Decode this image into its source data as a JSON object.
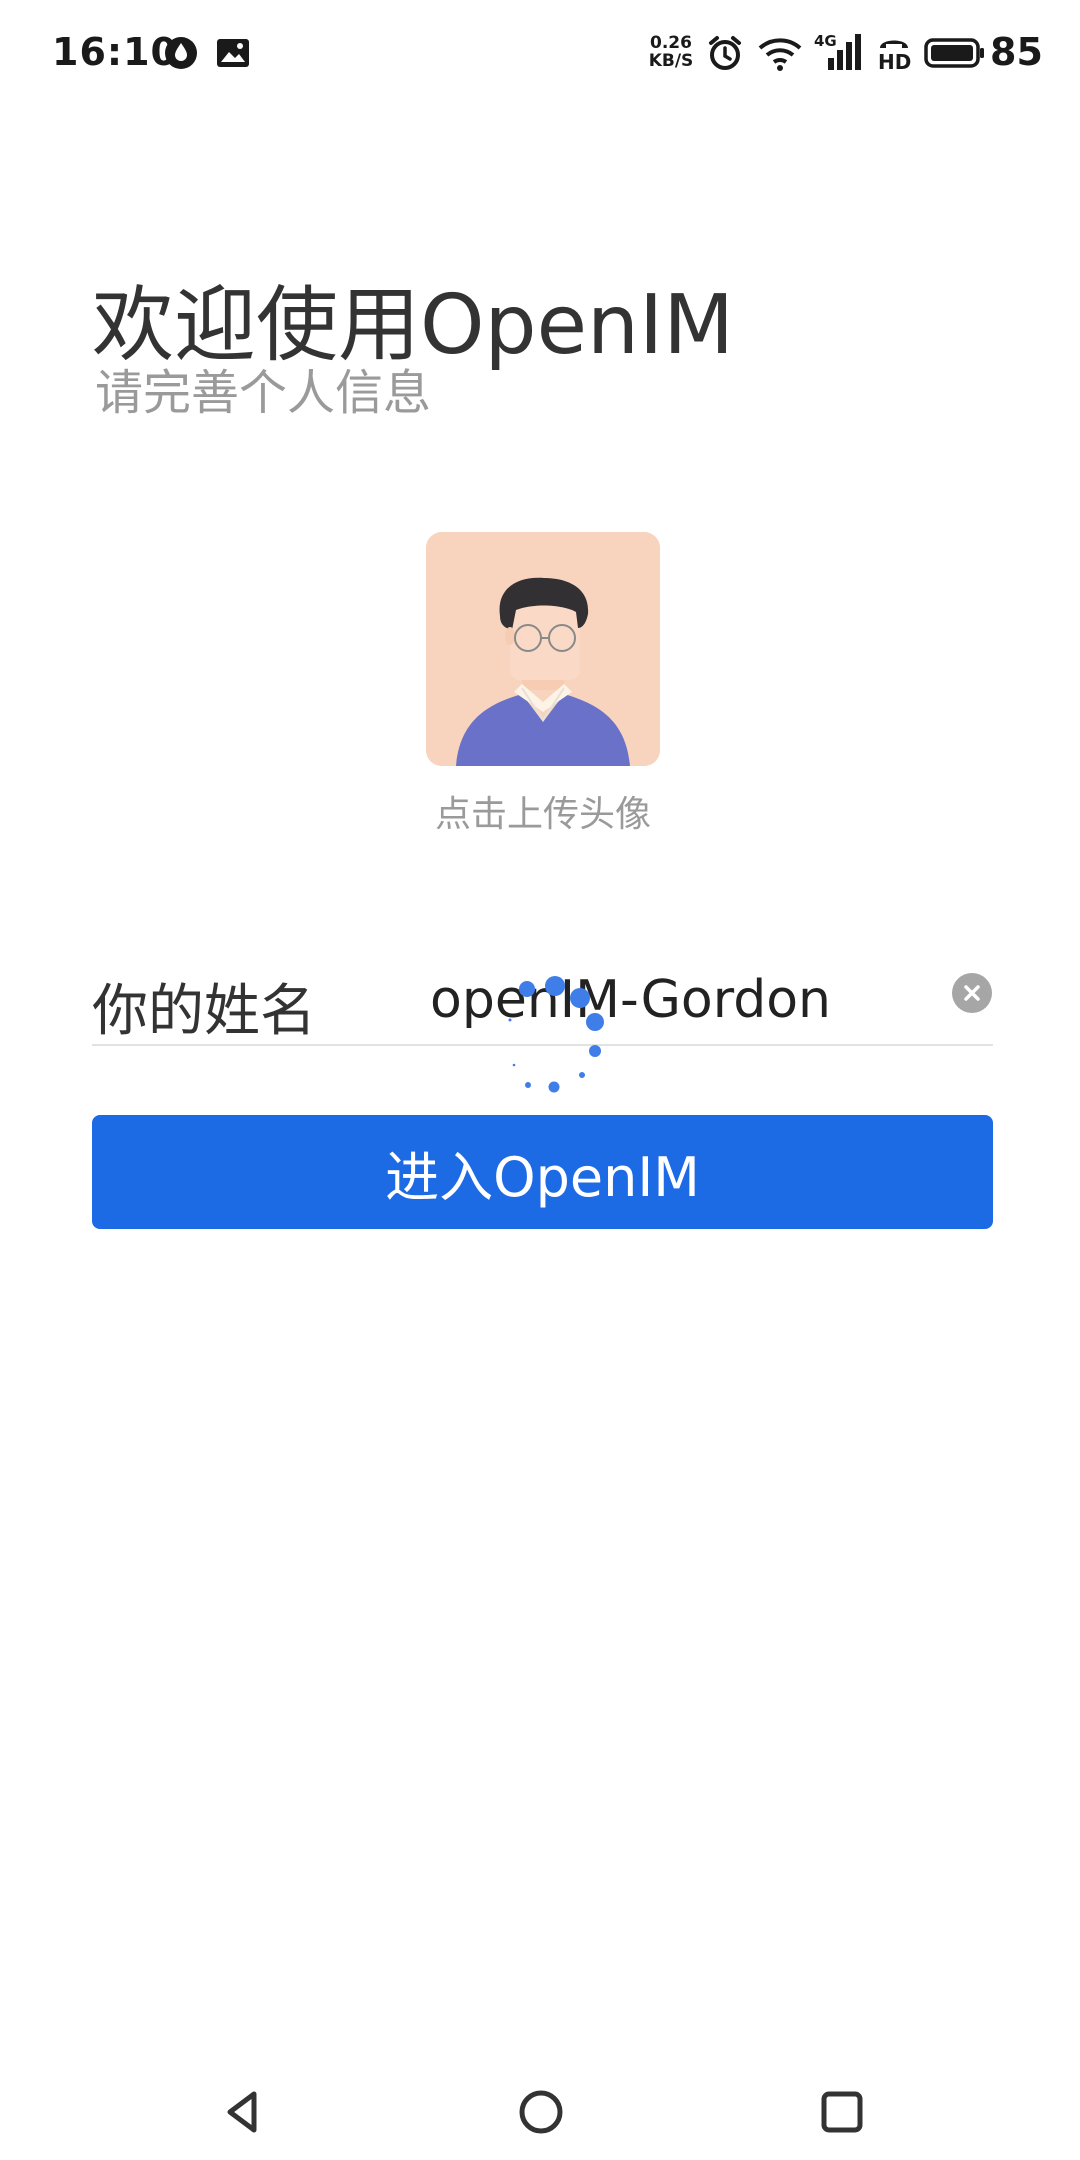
{
  "status_bar": {
    "time": "16:10",
    "net_speed_value": "0.26",
    "net_speed_unit": "KB/S",
    "network_type": "4G",
    "hd_label": "HD",
    "battery": "85"
  },
  "header": {
    "title": "欢迎使用OpenIM",
    "subtitle": "请完善个人信息"
  },
  "avatar": {
    "hint": "点击上传头像",
    "background_color": "#f8d4bf"
  },
  "name_field": {
    "label": "你的姓名",
    "value": "openIM-Gordon"
  },
  "enter_button": {
    "label": "进入OpenIM",
    "color": "#1d6ae5"
  },
  "colors": {
    "accent": "#1d6ae5",
    "text_primary": "#333333",
    "text_secondary": "#9a9a9a"
  }
}
